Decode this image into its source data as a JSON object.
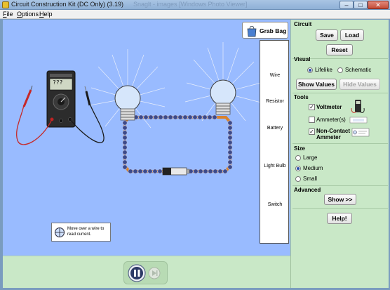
{
  "window": {
    "title": "Circuit Construction Kit (DC Only) (3.19)",
    "ghost_title": "Snaglt - images [Windows Photo Viewer]",
    "minimize_glyph": "–",
    "maximize_glyph": "□",
    "close_glyph": "✕"
  },
  "menu": [
    "File",
    "Options",
    "Help"
  ],
  "canvas": {
    "grab_bag_label": "Grab Bag",
    "voltmeter_reading": "???",
    "hint_text": "Move over a wire to read current."
  },
  "toolbox": {
    "wire": "Wire",
    "resistor": "Resistor",
    "battery": "Battery",
    "light_bulb": "Light Bulb",
    "switch": "Switch"
  },
  "panel": {
    "circuit": {
      "title": "Circuit",
      "save": "Save",
      "load": "Load",
      "reset": "Reset"
    },
    "visual": {
      "title": "Visual",
      "lifelike": "Lifelike",
      "schematic": "Schematic",
      "selected": "Lifelike",
      "show_values": "Show Values",
      "hide_values": "Hide Values"
    },
    "tools": {
      "title": "Tools",
      "voltmeter": "Voltmeter",
      "ammeter": "Ammeter(s)",
      "noncontact_line1": "Non-Contact",
      "noncontact_line2": "Ammeter",
      "voltmeter_checked": true,
      "ammeter_checked": false,
      "noncontact_checked": true
    },
    "size": {
      "title": "Size",
      "large": "Large",
      "medium": "Medium",
      "small": "Small",
      "selected": "Medium"
    },
    "advanced": {
      "title": "Advanced",
      "show": "Show >>"
    },
    "help": "Help!"
  },
  "icons": [
    "grab-bag-icon",
    "pause-icon",
    "step-icon",
    "crosshair-icon"
  ],
  "colors": {
    "canvas": "#99bbff",
    "panel": "#c9e8c7",
    "wire_bead": "#3a3a8a",
    "wire_link": "#d9822b"
  }
}
